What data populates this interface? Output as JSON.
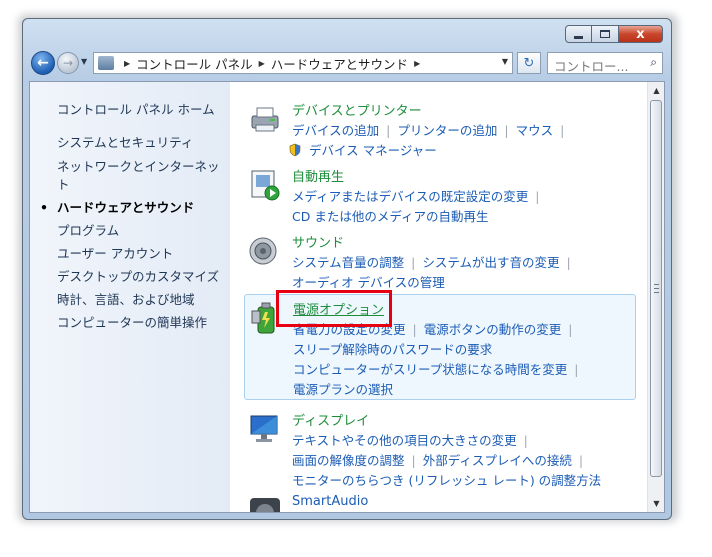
{
  "window": {
    "close_glyph": "x"
  },
  "navbar": {
    "breadcrumb": [
      "コントロール パネル",
      "ハードウェアとサウンド"
    ],
    "search_placeholder": "コントロー..."
  },
  "sidebar": {
    "items": [
      {
        "label": "コントロール パネル ホーム"
      },
      {
        "label": "システムとセキュリティ"
      },
      {
        "label": "ネットワークとインターネット"
      },
      {
        "label": "ハードウェアとサウンド",
        "current": true
      },
      {
        "label": "プログラム"
      },
      {
        "label": "ユーザー アカウント"
      },
      {
        "label": "デスクトップのカスタマイズ"
      },
      {
        "label": "時計、言語、および地域"
      },
      {
        "label": "コンピューターの簡単操作"
      }
    ]
  },
  "categories": [
    {
      "title": "デバイスとプリンター",
      "icon": "printer-icon",
      "lines": [
        [
          "デバイスの追加",
          "プリンターの追加",
          "マウス"
        ],
        [
          "デバイス マネージャー"
        ]
      ]
    },
    {
      "title": "自動再生",
      "icon": "autoplay-icon",
      "lines": [
        [
          "メディアまたはデバイスの既定設定の変更"
        ],
        [
          "CD または他のメディアの自動再生"
        ]
      ]
    },
    {
      "title": "サウンド",
      "icon": "speaker-icon",
      "lines": [
        [
          "システム音量の調整",
          "システムが出す音の変更"
        ],
        [
          "オーディオ デバイスの管理"
        ]
      ]
    },
    {
      "title": "電源オプション",
      "icon": "battery-icon",
      "highlighted": true,
      "lines": [
        [
          "省電力の設定の変更",
          "電源ボタンの動作の変更"
        ],
        [
          "スリープ解除時のパスワードの要求"
        ],
        [
          "コンピューターがスリープ状態になる時間を変更"
        ],
        [
          "電源プランの選択"
        ]
      ]
    },
    {
      "title": "ディスプレイ",
      "icon": "monitor-icon",
      "lines": [
        [
          "テキストやその他の項目の大きさの変更"
        ],
        [
          "画面の解像度の調整",
          "外部ディスプレイへの接続"
        ],
        [
          "モニターのちらつき (リフレッシュ レート) の調整方法"
        ]
      ]
    },
    {
      "title": "SmartAudio",
      "icon": "smartaudio-icon",
      "lines": []
    }
  ],
  "colors": {
    "category_title": "#1d8d3b",
    "link": "#1c5cb5",
    "highlight_box": "#e60012"
  }
}
